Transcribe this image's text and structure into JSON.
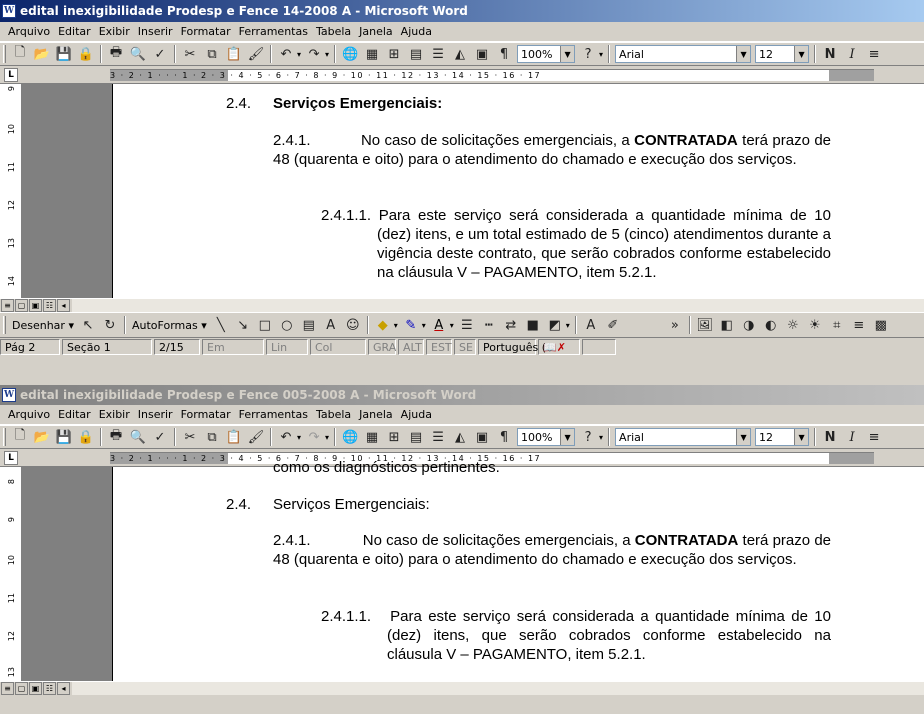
{
  "window1": {
    "title": "edital inexigibilidade Prodesp e Fence 14-2008 A - Microsoft Word",
    "menu": [
      "Arquivo",
      "Editar",
      "Exibir",
      "Inserir",
      "Formatar",
      "Ferramentas",
      "Tabela",
      "Janela",
      "Ajuda"
    ],
    "zoom": "100%",
    "font": "Arial",
    "font_size": "12",
    "ruler_numbers": "3 · 2 · 1 · · · 1 · 2 · 3 · 4 · 5 · 6 · 7 · 8 · 9 · 10 · 11 · 12 · 13 · 14 · 15 · 16 · 17",
    "vruler_numbers": [
      "9",
      "10",
      "11",
      "12",
      "13",
      "14"
    ],
    "section_num": "2.4.",
    "section_title": "Serviços Emergenciais:",
    "p1_num": "2.4.1.",
    "p1_pre": "No caso de solicitações emergenciais, a",
    "p1_bold": "CONTRATADA",
    "p1_post": "terá prazo de 48 (quarenta e oito) para o atendimento do chamado e execução dos serviços.",
    "p2_num": "2.4.1.1.",
    "p2_text": "Para este serviço será considerada a quantidade mínima de 10 (dez) itens, e um total estimado de 5 (cinco) atendimentos durante a vigência deste contrato, que serão cobrados conforme estabelecido na cláusula V – PAGAMENTO, item 5.2.1.",
    "drawing": {
      "draw_label": "Desenhar",
      "autoshapes_label": "AutoFormas"
    },
    "status": {
      "page": "Pág 2",
      "section": "Seção 1",
      "pages": "2/15",
      "at": "Em",
      "line": "Lin",
      "col": "Col",
      "rec": "GRA",
      "trk": "ALT",
      "ext": "EST",
      "ovr": "SE",
      "lang": "Português ("
    }
  },
  "window2": {
    "title": "edital inexigibilidade Prodesp e Fence 005-2008 A - Microsoft Word",
    "menu": [
      "Arquivo",
      "Editar",
      "Exibir",
      "Inserir",
      "Formatar",
      "Ferramentas",
      "Tabela",
      "Janela",
      "Ajuda"
    ],
    "zoom": "100%",
    "font": "Arial",
    "font_size": "12",
    "ruler_numbers": "3 · 2 · 1 · · · 1 · 2 · 3 · 4 · 5 · 6 · 7 · 8 · 9 · 10 · 11 · 12 · 13 · 14 · 15 · 16 · 17",
    "vruler_numbers": [
      "8",
      "9",
      "10",
      "11",
      "12",
      "13"
    ],
    "cut_line": "como os diagnósticos pertinentes.",
    "section_num": "2.4.",
    "section_title": "Serviços Emergenciais:",
    "p1_num": "2.4.1.",
    "p1_pre": "No caso de solicitações emergenciais, a",
    "p1_bold": "CONTRATADA",
    "p1_post": "terá prazo de 48 (quarenta e oito) para o atendimento do chamado e execução dos serviços.",
    "p2_num": "2.4.1.1.",
    "p2_text": "Para este serviço será considerada a quantidade mínima de 10 (dez) itens, que serão cobrados conforme estabelecido na cláusula V – PAGAMENTO, item 5.2.1."
  }
}
